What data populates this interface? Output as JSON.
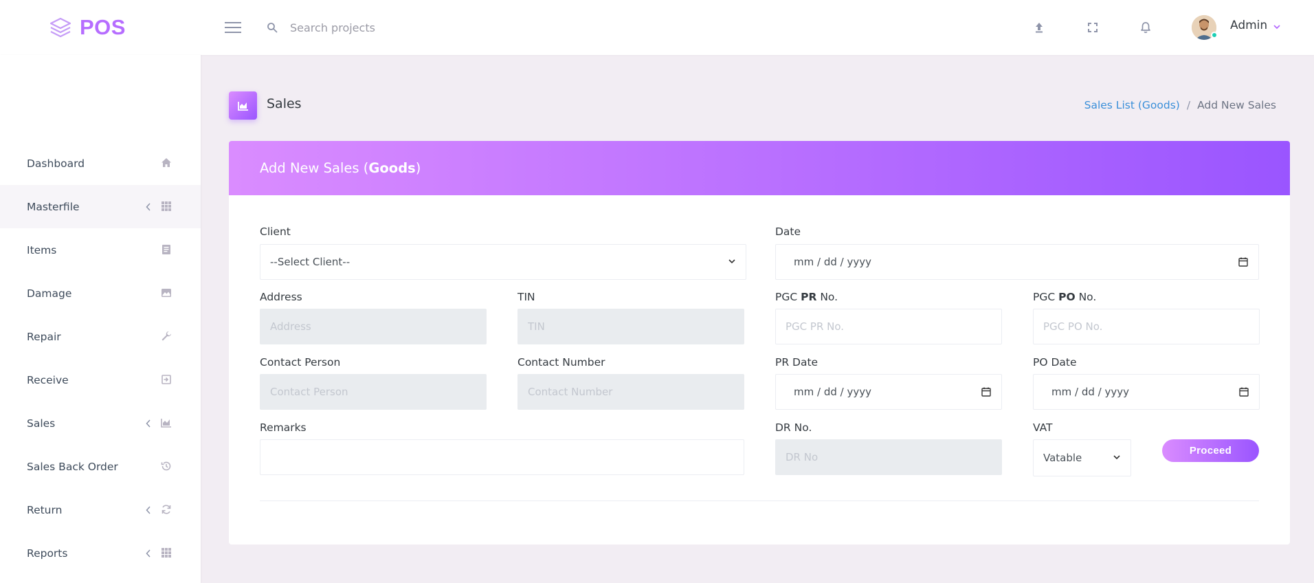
{
  "app": {
    "brand": "POS"
  },
  "topbar": {
    "search_placeholder": "Search projects",
    "user_name": "Admin"
  },
  "sidebar": {
    "items": [
      {
        "label": "Dashboard",
        "icon": "home-icon",
        "has_caret": false,
        "active": false
      },
      {
        "label": "Masterfile",
        "icon": "grid-icon",
        "has_caret": true,
        "active": true
      },
      {
        "label": "Items",
        "icon": "document-icon",
        "has_caret": false,
        "active": false
      },
      {
        "label": "Damage",
        "icon": "broken-image-icon",
        "has_caret": false,
        "active": false
      },
      {
        "label": "Repair",
        "icon": "wrench-icon",
        "has_caret": false,
        "active": false
      },
      {
        "label": "Receive",
        "icon": "login-box-icon",
        "has_caret": false,
        "active": false
      },
      {
        "label": "Sales",
        "icon": "area-chart-icon",
        "has_caret": true,
        "active": false
      },
      {
        "label": "Sales Back Order",
        "icon": "history-icon",
        "has_caret": false,
        "active": false
      },
      {
        "label": "Return",
        "icon": "refresh-icon",
        "has_caret": true,
        "active": false
      },
      {
        "label": "Reports",
        "icon": "grid-icon",
        "has_caret": true,
        "active": false
      }
    ]
  },
  "page": {
    "title": "Sales",
    "breadcrumb": {
      "link": "Sales List (Goods)",
      "separator": "/",
      "current": "Add New Sales"
    }
  },
  "form": {
    "header_prefix": "Add New Sales (",
    "header_bold": "Goods",
    "header_suffix": ")",
    "client": {
      "label": "Client",
      "value": "--Select Client--"
    },
    "date": {
      "label": "Date",
      "value": "mm / dd / yyyy"
    },
    "address": {
      "label": "Address",
      "placeholder": "Address"
    },
    "tin": {
      "label": "TIN",
      "placeholder": "TIN"
    },
    "pgc_pr": {
      "label_prefix": "PGC ",
      "label_bold": "PR",
      "label_suffix": " No.",
      "placeholder": "PGC PR No."
    },
    "pgc_po": {
      "label_prefix": "PGC ",
      "label_bold": "PO",
      "label_suffix": " No.",
      "placeholder": "PGC PO No."
    },
    "contact_person": {
      "label": "Contact Person",
      "placeholder": "Contact Person"
    },
    "contact_number": {
      "label": "Contact Number",
      "placeholder": "Contact Number"
    },
    "pr_date": {
      "label": "PR Date",
      "value": "mm / dd / yyyy"
    },
    "po_date": {
      "label": "PO Date",
      "value": "mm / dd / yyyy"
    },
    "remarks": {
      "label": "Remarks",
      "placeholder": ""
    },
    "dr_no": {
      "label": "DR No.",
      "placeholder": "DR No"
    },
    "vat": {
      "label": "VAT",
      "value": "Vatable"
    },
    "proceed_label": "Proceed"
  },
  "colors": {
    "accent_start": "#da8cff",
    "accent_end": "#9a55ff",
    "link": "#3a8fd9",
    "online": "#1bcfb4"
  }
}
